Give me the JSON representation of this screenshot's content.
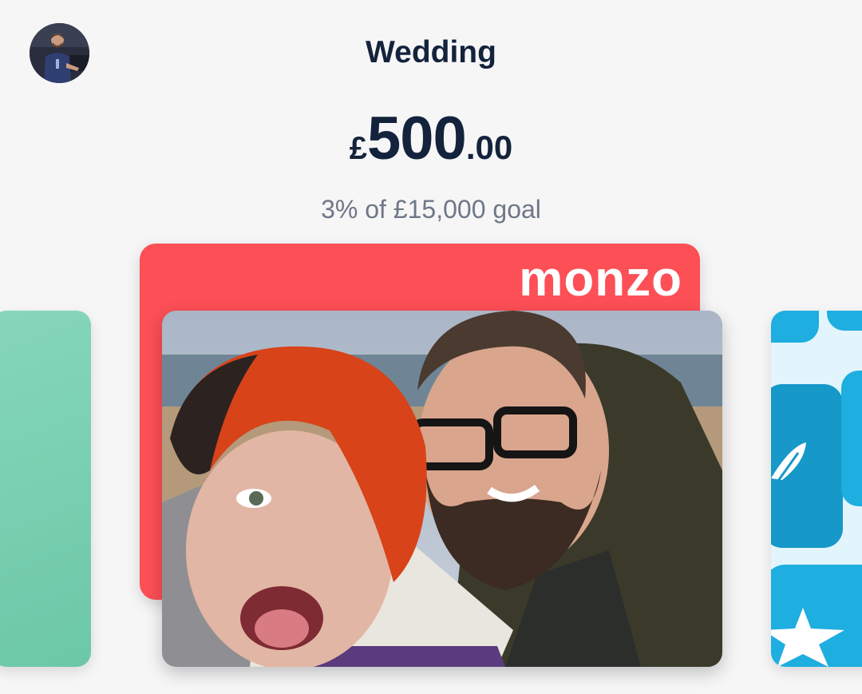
{
  "header": {
    "avatar_icon": "profile-photo-icon",
    "title": "Wedding"
  },
  "balance": {
    "currency": "£",
    "major": "500",
    "minor": ".00"
  },
  "goal": {
    "text": "3% of £15,000 goal",
    "progress_percent": 3
  },
  "cards": {
    "left_card_color": "#73cbab",
    "center_card": {
      "brand": "monzo",
      "color": "#fc4f56",
      "image": "couple-selfie-photo"
    },
    "right_card_color": "#1eaee0",
    "right_card_icons": [
      "leaf-icon",
      "star-icon"
    ]
  },
  "colors": {
    "text_primary": "#14233c",
    "text_secondary": "#6f7787",
    "background": "#f6f6f7"
  }
}
